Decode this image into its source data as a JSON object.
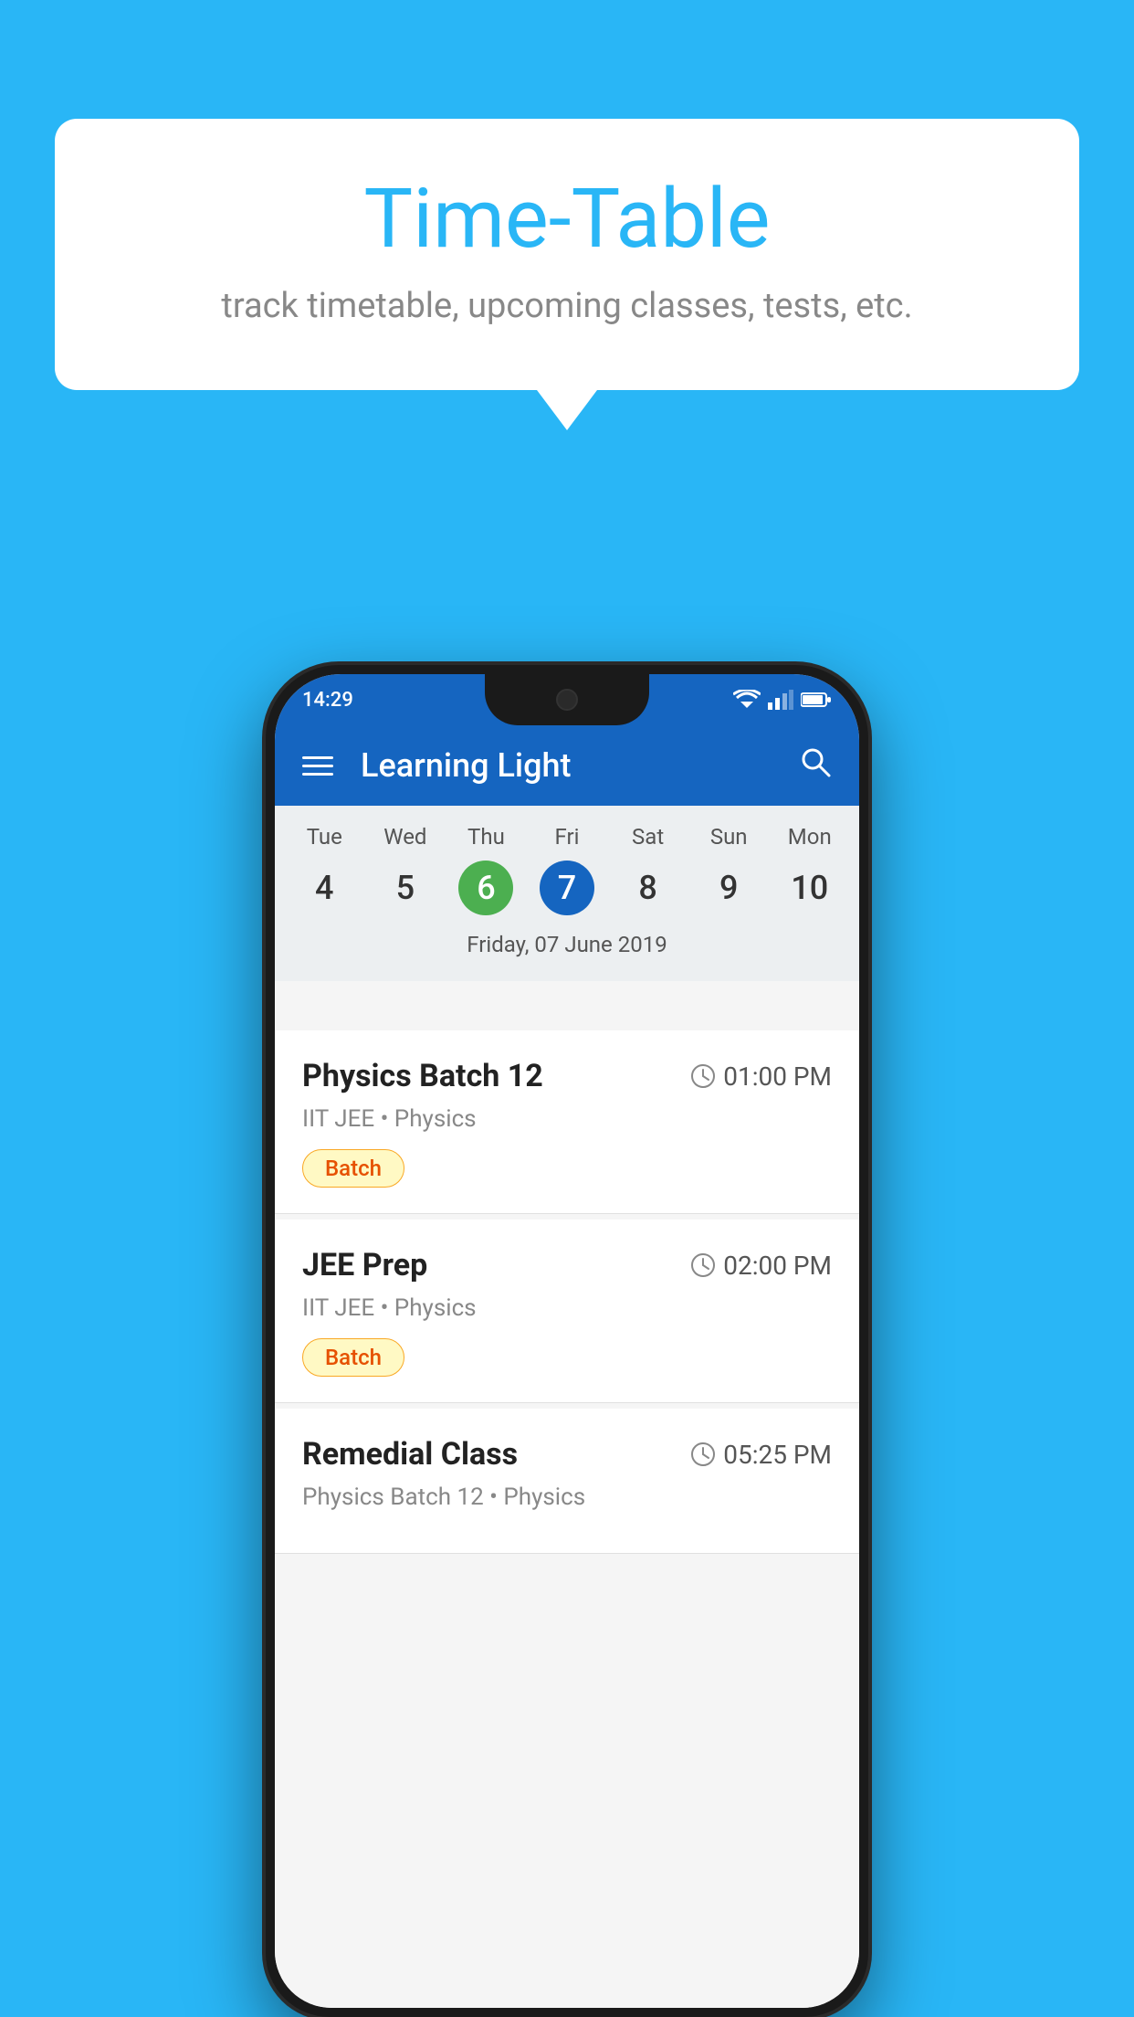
{
  "background_color": "#29B6F6",
  "bubble": {
    "title": "Time-Table",
    "subtitle": "track timetable, upcoming classes, tests, etc."
  },
  "status_bar": {
    "time": "14:29"
  },
  "app_bar": {
    "title": "Learning Light"
  },
  "calendar": {
    "days": [
      {
        "label": "Tue",
        "num": "4"
      },
      {
        "label": "Wed",
        "num": "5"
      },
      {
        "label": "Thu",
        "num": "6",
        "state": "today"
      },
      {
        "label": "Fri",
        "num": "7",
        "state": "selected"
      },
      {
        "label": "Sat",
        "num": "8"
      },
      {
        "label": "Sun",
        "num": "9"
      },
      {
        "label": "Mon",
        "num": "10"
      }
    ],
    "selected_date": "Friday, 07 June 2019"
  },
  "schedule": [
    {
      "name": "Physics Batch 12",
      "time": "01:00 PM",
      "meta_course": "IIT JEE",
      "meta_subject": "Physics",
      "badge": "Batch"
    },
    {
      "name": "JEE Prep",
      "time": "02:00 PM",
      "meta_course": "IIT JEE",
      "meta_subject": "Physics",
      "badge": "Batch"
    },
    {
      "name": "Remedial Class",
      "time": "05:25 PM",
      "meta_course": "Physics Batch 12",
      "meta_subject": "Physics",
      "badge": null
    }
  ],
  "icons": {
    "search": "🔍",
    "clock": "🕐",
    "bullet": "•"
  }
}
